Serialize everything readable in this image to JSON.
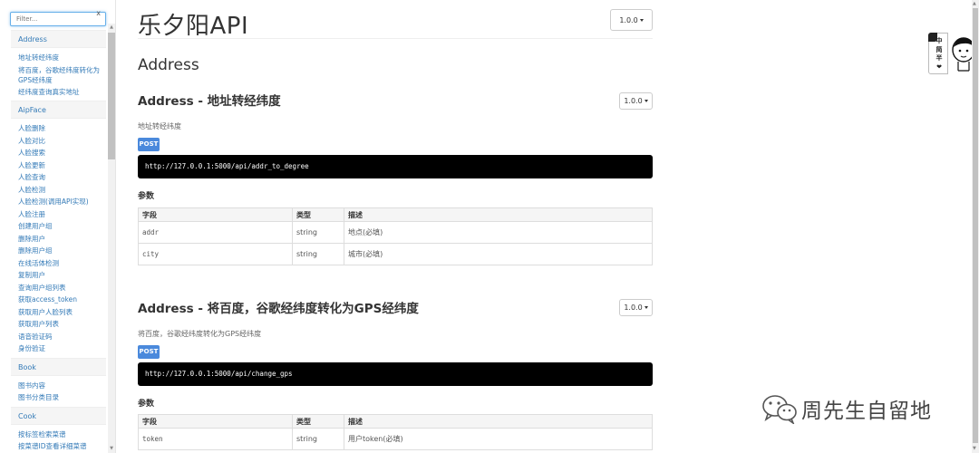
{
  "sidebar": {
    "filter_placeholder": "Filter...",
    "filter_clear": "x",
    "groups": [
      {
        "header": "Address",
        "items": [
          "地址转经纬度",
          "将百度，谷歌经纬度转化为GPS经纬度",
          "经纬度查询真实地址"
        ]
      },
      {
        "header": "AipFace",
        "items": [
          "人脸删除",
          "人脸对比",
          "人脸搜索",
          "人脸更新",
          "人脸查询",
          "人脸检测",
          "人脸检测(调用API实现)",
          "人脸注册",
          "创建用户组",
          "删除用户",
          "删除用户组",
          "在线活体检测",
          "复制用户",
          "查询用户组列表",
          "获取access_token",
          "获取用户人脸列表",
          "获取用户列表",
          "语音验证码",
          "身份验证"
        ]
      },
      {
        "header": "Book",
        "items": [
          "图书内容",
          "图书分类目录"
        ]
      },
      {
        "header": "Cook",
        "items": [
          "按标签检索菜谱",
          "按菜谱ID查看详细菜谱"
        ]
      }
    ]
  },
  "main": {
    "app_title": "乐夕阳API",
    "version_label": "1.0.0",
    "group_title": "Address",
    "sections": [
      {
        "title": "Address - 地址转经纬度",
        "version": "1.0.0",
        "description": "地址转经纬度",
        "method": "POST",
        "url": "http://127.0.0.1:5000/api/addr_to_degree",
        "params_label": "参数",
        "columns": [
          "字段",
          "类型",
          "描述"
        ],
        "rows": [
          {
            "field": "addr",
            "type": "string",
            "desc": "地点(必填)"
          },
          {
            "field": "city",
            "type": "string",
            "desc": "城市(必填)"
          }
        ]
      },
      {
        "title": "Address - 将百度，谷歌经纬度转化为GPS经纬度",
        "version": "1.0.0",
        "description": "将百度，谷歌经纬度转化为GPS经纬度",
        "method": "POST",
        "url": "http://127.0.0.1:5000/api/change_gps",
        "params_label": "参数",
        "columns": [
          "字段",
          "类型",
          "描述"
        ],
        "rows": [
          {
            "field": "token",
            "type": "string",
            "desc": "用户token(必填)"
          }
        ]
      }
    ]
  },
  "widget": {
    "chars": [
      "中",
      "简",
      "半",
      "❤"
    ]
  },
  "watermark": {
    "text": "周先生自留地",
    "icon": "wechat-icon"
  },
  "colors": {
    "link": "#337ab7",
    "post_badge": "#4a89dc",
    "url_bar": "#000000"
  }
}
